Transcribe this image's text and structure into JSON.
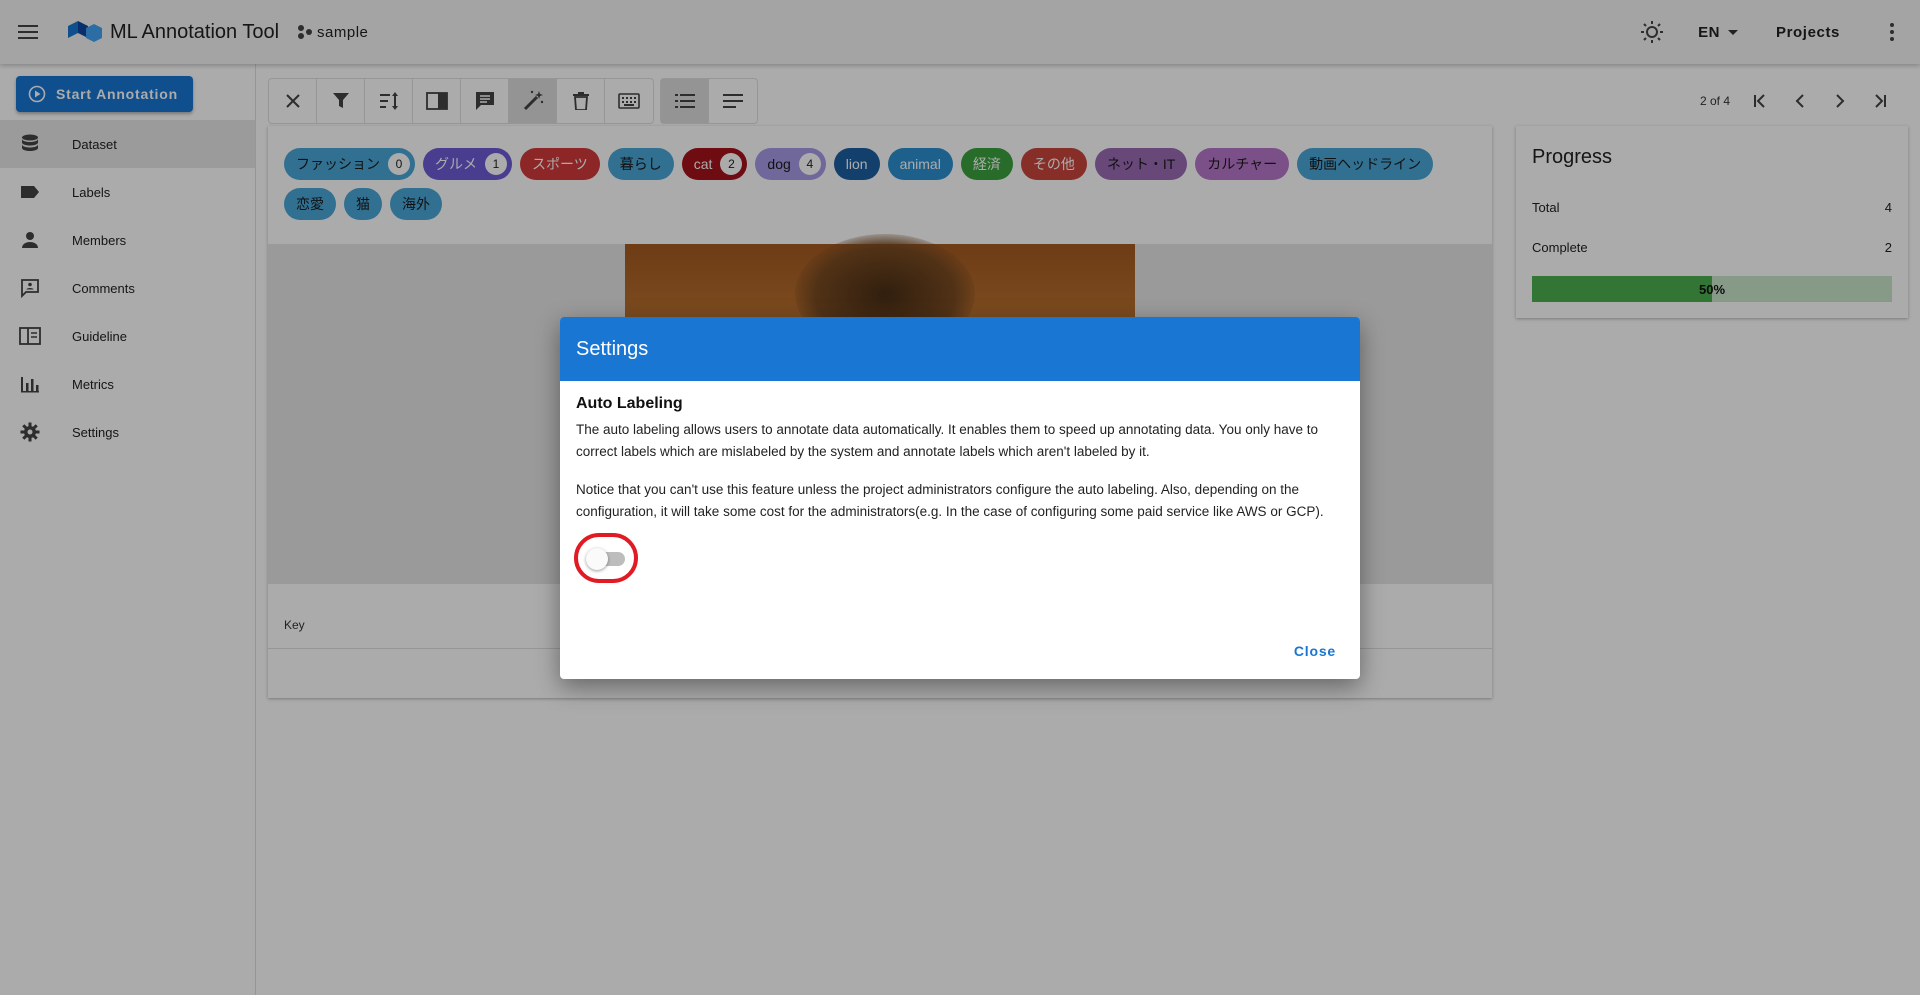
{
  "app": {
    "title": "ML Annotation Tool",
    "project_name": "sample",
    "language": "EN",
    "projects_label": "Projects"
  },
  "sidebar": {
    "start_button": "Start Annotation",
    "items": [
      {
        "label": "Dataset",
        "icon": "database-icon",
        "active": true
      },
      {
        "label": "Labels",
        "icon": "label-icon"
      },
      {
        "label": "Members",
        "icon": "person-icon"
      },
      {
        "label": "Comments",
        "icon": "comment-icon"
      },
      {
        "label": "Guideline",
        "icon": "book-icon"
      },
      {
        "label": "Metrics",
        "icon": "chart-icon"
      },
      {
        "label": "Settings",
        "icon": "gear-icon"
      }
    ]
  },
  "pager": {
    "text": "2 of 4"
  },
  "labels": [
    {
      "text": "ファッション",
      "count": "0",
      "color": "#4aa8d8",
      "dark_text": true
    },
    {
      "text": "グルメ",
      "count": "1",
      "color": "#6e5bd6"
    },
    {
      "text": "スポーツ",
      "count": "",
      "color": "#d33a3a"
    },
    {
      "text": "暮らし",
      "count": "",
      "color": "#4aa8d8",
      "dark_text": true
    },
    {
      "text": "cat",
      "count": "2",
      "color": "#a5121c"
    },
    {
      "text": "dog",
      "count": "4",
      "color": "#a79ae8",
      "dark_text": true
    },
    {
      "text": "lion",
      "count": "",
      "color": "#1d5fa3"
    },
    {
      "text": "animal",
      "count": "",
      "color": "#2c8fd0"
    },
    {
      "text": "経済",
      "count": "",
      "color": "#3ba23e"
    },
    {
      "text": "その他",
      "count": "",
      "color": "#c8453b"
    },
    {
      "text": "ネット・IT",
      "count": "",
      "color": "#9b6bb5",
      "dark_text": true
    },
    {
      "text": "カルチャー",
      "count": "",
      "color": "#b877c9",
      "dark_text": true
    },
    {
      "text": "動画ヘッドライン",
      "count": "",
      "color": "#4aa8d8",
      "dark_text": true
    },
    {
      "text": "恋愛",
      "count": "",
      "color": "#4aa8d8",
      "dark_text": true
    },
    {
      "text": "猫",
      "count": "",
      "color": "#4aa8d8",
      "dark_text": true
    },
    {
      "text": "海外",
      "count": "",
      "color": "#4aa8d8",
      "dark_text": true
    }
  ],
  "metadata": {
    "key_header": "Key"
  },
  "progress": {
    "title": "Progress",
    "total_label": "Total",
    "total_value": "4",
    "complete_label": "Complete",
    "complete_value": "2",
    "percent_label": "50%",
    "percent": 50
  },
  "dialog": {
    "title": "Settings",
    "subtitle": "Auto Labeling",
    "paragraph1": "The auto labeling allows users to annotate data automatically. It enables them to speed up annotating data. You only have to correct labels which are mislabeled by the system and annotate labels which aren't labeled by it.",
    "paragraph2": "Notice that you can't use this feature unless the project administrators configure the auto labeling. Also, depending on the configuration, it will take some cost for the administrators(e.g. In the case of configuring some paid service like AWS or GCP).",
    "toggle_on": false,
    "close_label": "Close"
  },
  "colors": {
    "primary": "#1976d2",
    "highlight": "#e01b24",
    "progress_fill": "#4caf50",
    "progress_track": "#c8e6c9"
  }
}
